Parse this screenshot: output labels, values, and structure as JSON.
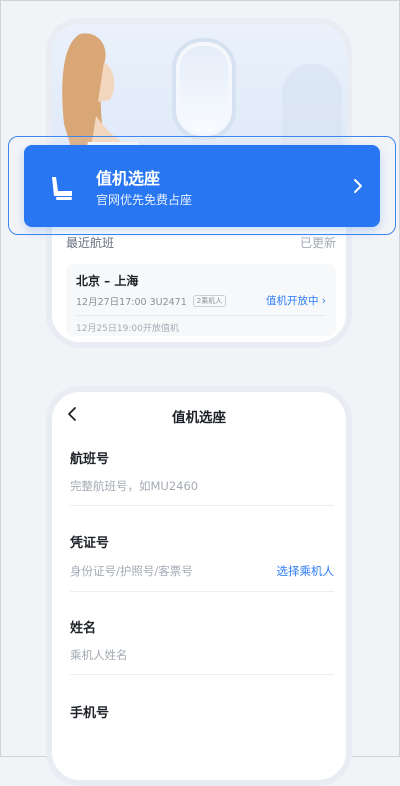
{
  "banner": {
    "title": "值机选座",
    "subtitle": "官网优先免费占座"
  },
  "recent": {
    "title": "最近航班",
    "updated": "已更新",
    "flight": {
      "route": "北京 – 上海",
      "details": "12月27日17:00 3U2471",
      "pax_badge": "2乘机人",
      "status": "值机开放中 ›",
      "open_time": "12月25日19:00开放值机"
    }
  },
  "form": {
    "nav_title": "值机选座",
    "fields": [
      {
        "label": "航班号",
        "placeholder": "完整航班号，如MU2460"
      },
      {
        "label": "凭证号",
        "placeholder": "身份证号/护照号/客票号",
        "link": "选择乘机人"
      },
      {
        "label": "姓名",
        "placeholder": "乘机人姓名"
      },
      {
        "label": "手机号",
        "placeholder": ""
      }
    ]
  },
  "colors": {
    "accent": "#2876f2",
    "link": "#2f7cf6",
    "background": "#f1f3f6"
  },
  "icons": {
    "banner_icon": "seat-icon",
    "banner_chevron": "chevron-right-icon",
    "back": "chevron-left-icon"
  }
}
